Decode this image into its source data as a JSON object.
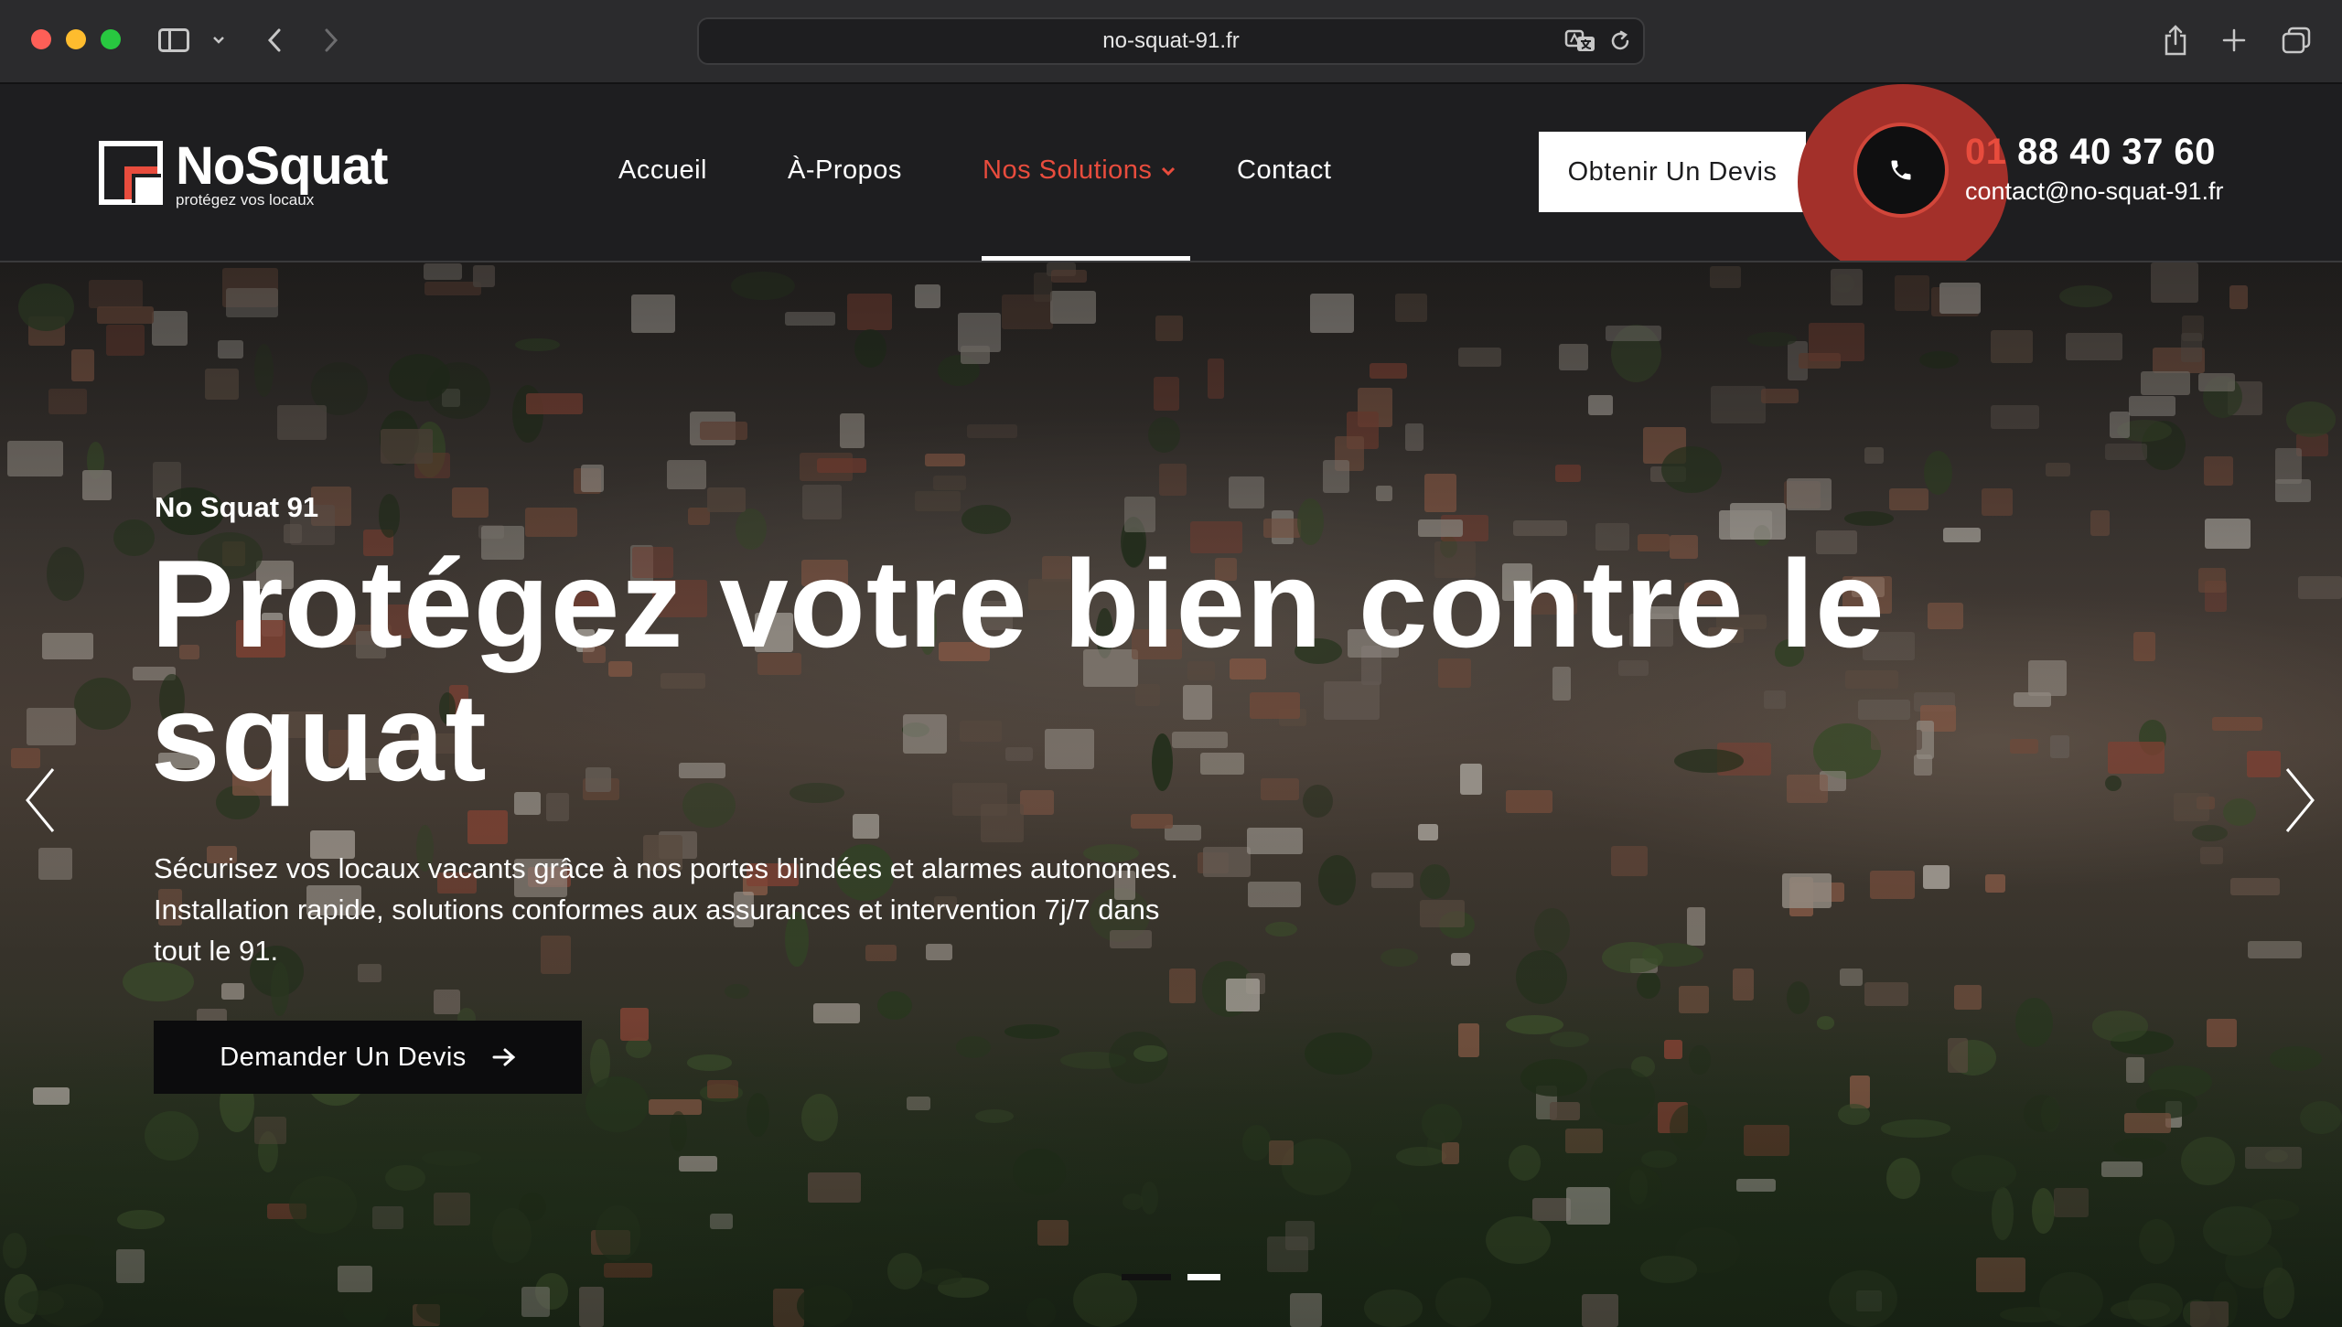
{
  "browser": {
    "url": "no-squat-91.fr"
  },
  "site": {
    "logo": {
      "name": "NoSquat",
      "tagline": "protégez vos locaux"
    },
    "nav": {
      "items": [
        {
          "label": "Accueil"
        },
        {
          "label": "À-Propos"
        },
        {
          "label": "Nos Solutions",
          "active": true
        },
        {
          "label": "Contact"
        }
      ]
    },
    "header_cta": "Obtenir Un Devis",
    "phone_prefix": "01",
    "phone_rest": " 88 40 37 60",
    "email": "contact@no-squat-91.fr"
  },
  "hero": {
    "eyebrow": "No Squat 91",
    "title": "Protégez votre bien contre le squat",
    "description": "Sécurisez vos locaux vacants grâce à nos portes blindées et alarmes autonomes. Installation rapide, solutions conformes aux assurances et intervention 7j/7 dans tout le 91.",
    "cta": "Demander Un Devis",
    "slides": 2,
    "active_slide": 2
  },
  "colors": {
    "accent": "#e84c3d",
    "header_bg": "#1e1e20"
  },
  "icons": [
    "sidebar-icon",
    "chevron-down-icon",
    "back-icon",
    "forward-icon",
    "translate-icon",
    "reload-icon",
    "share-icon",
    "plus-icon",
    "tabs-icon",
    "phone-icon",
    "arrow-right-icon",
    "chevron-left-icon",
    "chevron-right-icon"
  ]
}
